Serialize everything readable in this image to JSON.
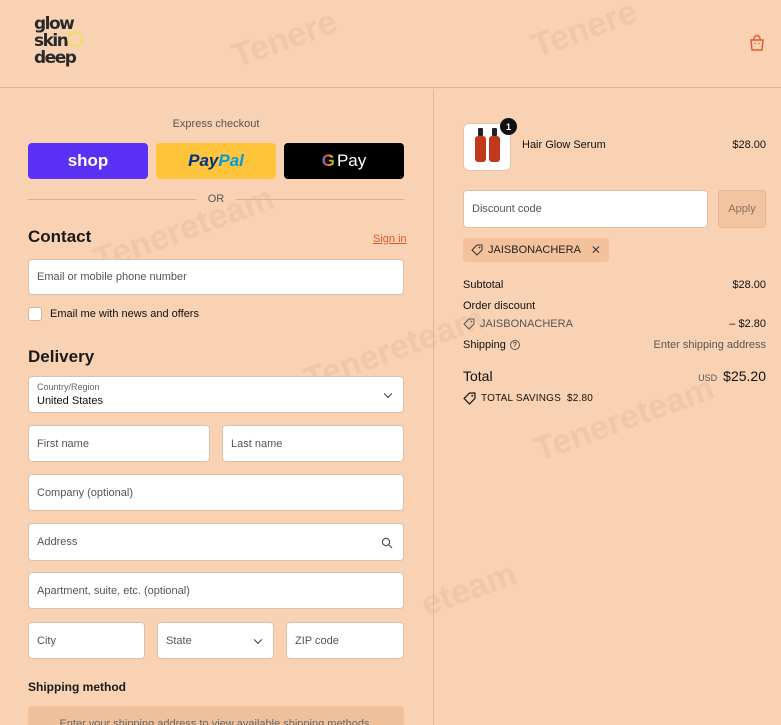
{
  "brand": {
    "logo_line1": "glow",
    "logo_line2": "skin",
    "logo_line3": "deep"
  },
  "icons": {
    "cart": "shopping-bag-icon",
    "search": "search-icon",
    "tag": "tag-icon",
    "close": "close-icon",
    "help": "help-circle-icon",
    "chevron": "chevron-down-icon"
  },
  "express": {
    "label": "Express checkout",
    "shop_label": "shop",
    "paypal_part1": "Pay",
    "paypal_part2": "Pal",
    "gpay_g": "G",
    "gpay_label": "Pay",
    "or_label": "OR"
  },
  "contact": {
    "title": "Contact",
    "signin_label": "Sign in",
    "email_placeholder": "Email or mobile phone number",
    "newsletter_label": "Email me with news and offers"
  },
  "delivery": {
    "title": "Delivery",
    "country_label": "Country/Region",
    "country_value": "United States",
    "first_name": "First name",
    "last_name": "Last name",
    "company": "Company (optional)",
    "address": "Address",
    "apartment": "Apartment, suite, etc. (optional)",
    "city": "City",
    "state": "State",
    "zip": "ZIP code"
  },
  "shipping": {
    "title": "Shipping method",
    "placeholder": "Enter your shipping address to view available shipping methods."
  },
  "order": {
    "item": {
      "name": "Hair Glow Serum",
      "price": "$28.00",
      "qty": "1"
    },
    "discount_placeholder": "Discount code",
    "apply_label": "Apply",
    "code": "JAISBONACHERA",
    "subtotal_label": "Subtotal",
    "subtotal_value": "$28.00",
    "order_discount_label": "Order discount",
    "discount_code": "JAISBONACHERA",
    "discount_value": "– $2.80",
    "shipping_label": "Shipping",
    "shipping_value": "Enter shipping address",
    "total_label": "Total",
    "currency": "USD",
    "total_value": "$25.20",
    "savings_label": "TOTAL SAVINGS",
    "savings_value": "$2.80"
  },
  "colors": {
    "background": "#f9d2b3",
    "shop": "#5a31f4",
    "paypal": "#ffc439",
    "gpay": "#000000",
    "link": "#e4572e"
  }
}
